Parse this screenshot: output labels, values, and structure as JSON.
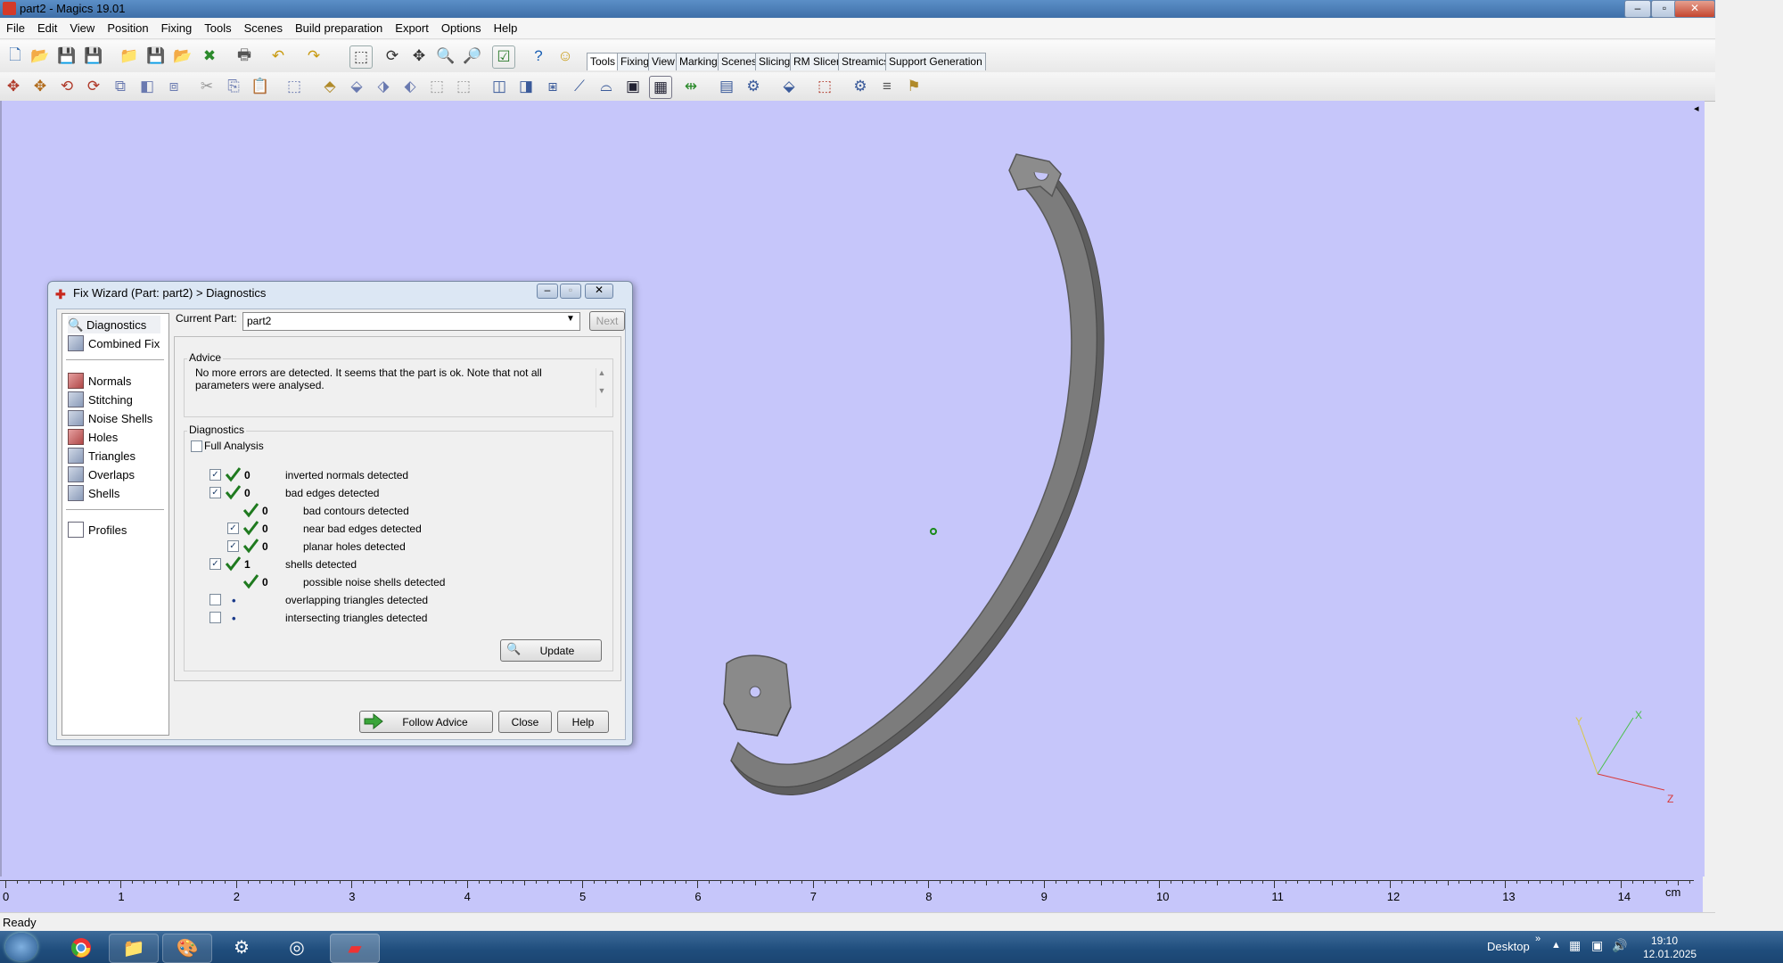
{
  "window": {
    "title": "part2 - Magics 19.01"
  },
  "menu": [
    "File",
    "Edit",
    "View",
    "Position",
    "Fixing",
    "Tools",
    "Scenes",
    "Build preparation",
    "Export",
    "Options",
    "Help"
  ],
  "toolbar_tabs": [
    "Tools",
    "Fixing",
    "View",
    "Marking",
    "Scenes",
    "Slicing",
    "RM Slicer",
    "Streamics",
    "Support Generation"
  ],
  "active_tab": "Tools",
  "dialog": {
    "title": "Fix Wizard (Part: part2) > Diagnostics",
    "nav_top": [
      "Diagnostics",
      "Combined Fix"
    ],
    "nav_mid": [
      "Normals",
      "Stitching",
      "Noise Shells",
      "Holes",
      "Triangles",
      "Overlaps",
      "Shells"
    ],
    "nav_bottom": [
      "Profiles"
    ],
    "current_part_label": "Current Part:",
    "current_part_value": "part2",
    "next_label": "Next",
    "advice_title": "Advice",
    "advice_text": "No more errors are detected. It seems that the part is ok. Note that not all parameters were analysed.",
    "diagnostics_title": "Diagnostics",
    "full_analysis_label": "Full Analysis",
    "rows": [
      {
        "checked": true,
        "status": "ok",
        "value": "0",
        "label": "inverted normals detected",
        "indent": 0
      },
      {
        "checked": true,
        "status": "ok",
        "value": "0",
        "label": "bad edges detected",
        "indent": 0
      },
      {
        "checked": null,
        "status": "ok",
        "value": "0",
        "label": "bad contours detected",
        "indent": 1
      },
      {
        "checked": true,
        "status": "ok",
        "value": "0",
        "label": "near bad edges detected",
        "indent": 1
      },
      {
        "checked": true,
        "status": "ok",
        "value": "0",
        "label": "planar holes detected",
        "indent": 1
      },
      {
        "checked": true,
        "status": "ok",
        "value": "1",
        "label": "shells detected",
        "indent": 0
      },
      {
        "checked": null,
        "status": "ok",
        "value": "0",
        "label": "possible noise shells detected",
        "indent": 1
      },
      {
        "checked": false,
        "status": "none",
        "value": "",
        "label": "overlapping triangles detected",
        "indent": 0
      },
      {
        "checked": false,
        "status": "none",
        "value": "",
        "label": "intersecting triangles detected",
        "indent": 0
      }
    ],
    "update_label": "Update",
    "follow_advice_label": "Follow Advice",
    "close_label": "Close",
    "help_label": "Help"
  },
  "ruler": {
    "labels": [
      "0",
      "1",
      "2",
      "3",
      "4",
      "5",
      "6",
      "7",
      "8",
      "9",
      "10",
      "11",
      "12",
      "13",
      "14"
    ],
    "unit": "cm"
  },
  "axes": {
    "x": "X",
    "y": "Y",
    "z": "Z"
  },
  "status": "Ready",
  "taskbar": {
    "desktop_label": "Desktop",
    "time": "19:10",
    "date": "12.01.2025"
  },
  "colors": {
    "viewport": "#c6c6fa",
    "part": "#7a7a7a",
    "accent_ok": "#1f7a1f"
  }
}
